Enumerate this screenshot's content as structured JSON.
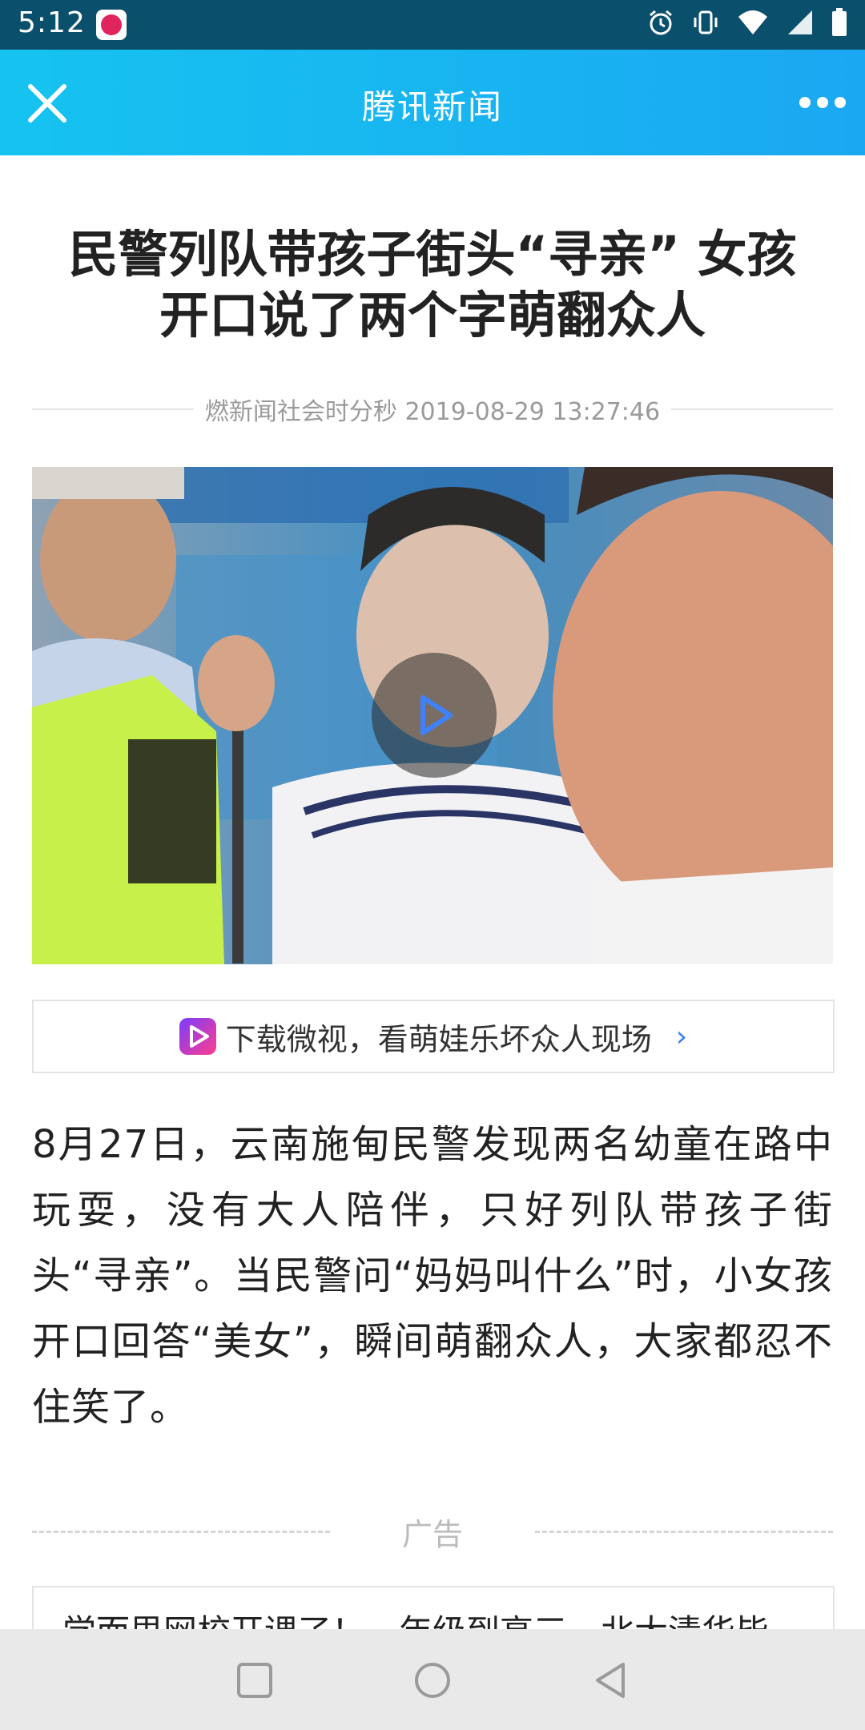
{
  "status_bar": {
    "time": "5:12"
  },
  "app_bar": {
    "title": "腾讯新闻"
  },
  "article": {
    "title": "民警列队带孩子街头“寻亲” 女孩开口说了两个字萌翻众人",
    "meta": "燃新闻社会时分秒 2019-08-29 13:27:46",
    "promo_text": "下载微视，看萌娃乐坏众人现场",
    "promo_arrow": "›",
    "body": "8月27日，云南施甸民警发现两名幼童在路中玩耍，没有大人陪伴，只好列队带孩子街头“寻亲”。当民警问“妈妈叫什么”时，小女孩开口回答“美女”，瞬间萌翻众人，大家都忍不住笑了。"
  },
  "ad": {
    "label": "广告",
    "card_text": "学而思网校开课了！一年级到高三，北大清华毕"
  },
  "colors": {
    "accent": "#16c3f0",
    "status_bar": "#0a4f6b",
    "link": "#3a7bf0"
  },
  "icons": [
    "close-icon",
    "more-icon",
    "play-icon",
    "weishi-logo-icon",
    "alarm-icon",
    "vibrate-icon",
    "wifi-icon",
    "signal-icon",
    "battery-icon",
    "nav-recents-icon",
    "nav-home-icon",
    "nav-back-icon"
  ]
}
